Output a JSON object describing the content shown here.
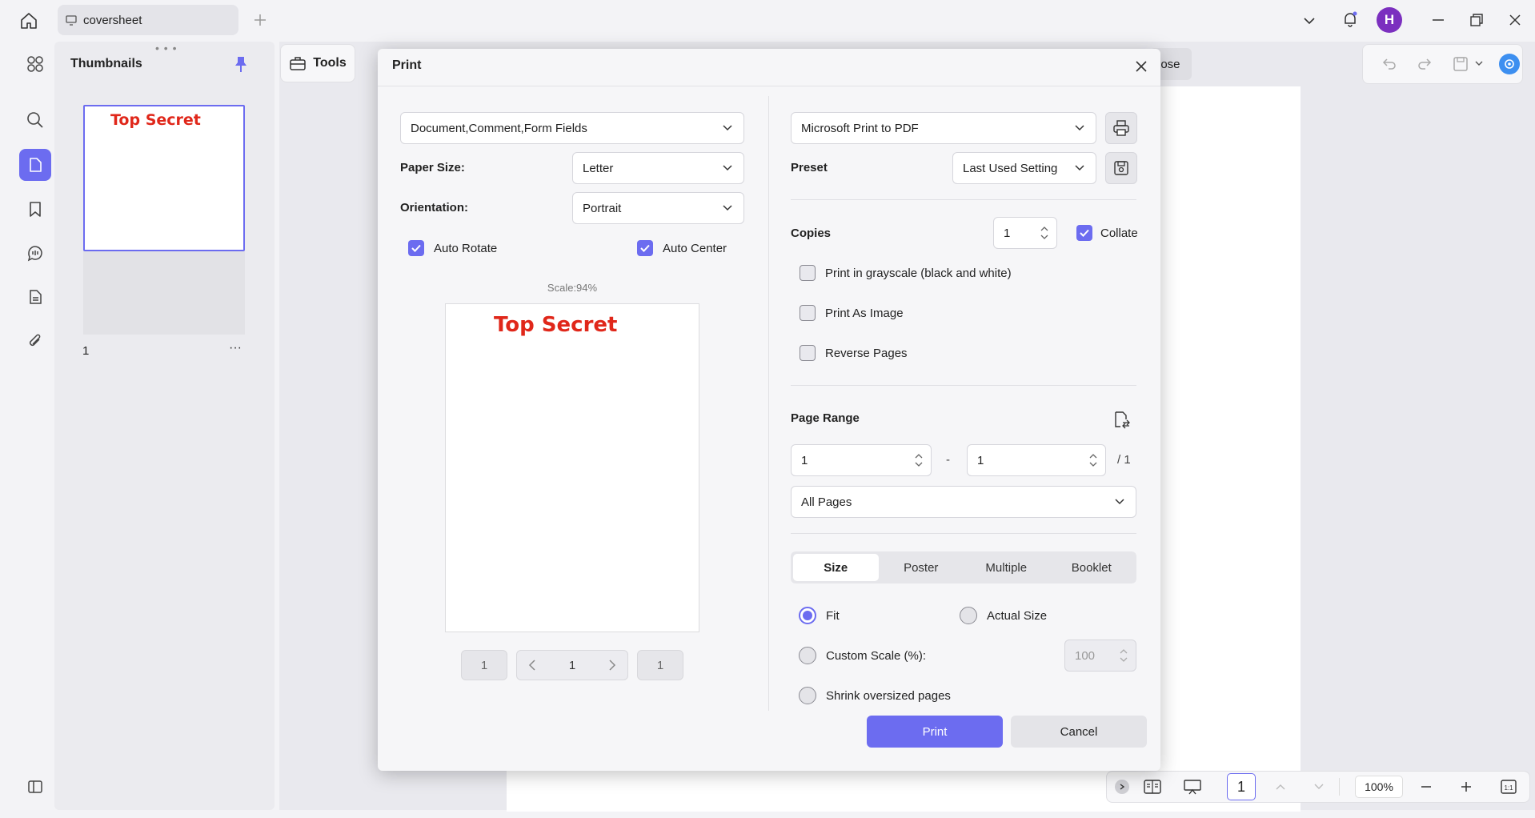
{
  "tab": {
    "title": "coversheet"
  },
  "user": {
    "initial": "H"
  },
  "thumbnails": {
    "title": "Thumbnails",
    "page_text": "Top Secret",
    "page_number": "1",
    "more": "···"
  },
  "toolbar": {
    "tools_label": "Tools",
    "close_partial": "lose"
  },
  "bottom_bar": {
    "page_number": "1",
    "zoom": "100%"
  },
  "print_dialog": {
    "title": "Print",
    "content_select": "Document,Comment,Form Fields",
    "paper_size_label": "Paper Size:",
    "paper_size_value": "Letter",
    "orientation_label": "Orientation:",
    "orientation_value": "Portrait",
    "auto_rotate_label": "Auto Rotate",
    "auto_center_label": "Auto Center",
    "scale_text": "Scale:94%",
    "preview_text": "Top Secret",
    "pager": {
      "first": "1",
      "current": "1",
      "last": "1"
    },
    "printer_value": "Microsoft Print to PDF",
    "preset_label": "Preset",
    "preset_value": "Last Used Setting",
    "copies_label": "Copies",
    "copies_value": "1",
    "collate_label": "Collate",
    "grayscale_label": "Print in grayscale (black and white)",
    "as_image_label": "Print As Image",
    "reverse_label": "Reverse Pages",
    "page_range_label": "Page Range",
    "range_from": "1",
    "range_dash": "-",
    "range_to": "1",
    "range_total": "/ 1",
    "pages_select": "All Pages",
    "tabs": [
      "Size",
      "Poster",
      "Multiple",
      "Booklet"
    ],
    "fit_label": "Fit",
    "actual_size_label": "Actual Size",
    "custom_scale_label": "Custom Scale (%):",
    "custom_scale_value": "100",
    "shrink_label": "Shrink oversized pages",
    "print_button": "Print",
    "cancel_button": "Cancel"
  },
  "colors": {
    "accent": "#6c6cf0",
    "secret_red": "#e0271a",
    "avatar": "#7b2fbf"
  }
}
